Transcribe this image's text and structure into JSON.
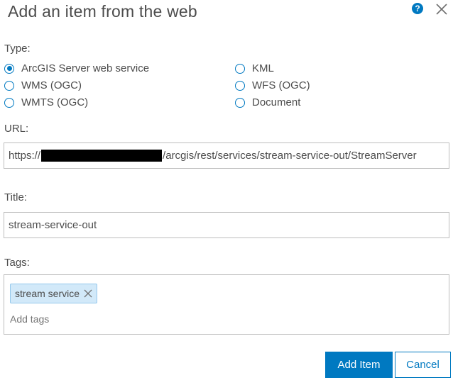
{
  "dialog": {
    "title": "Add an item from the web",
    "help_icon": "question-circle-icon",
    "close_icon": "close-icon"
  },
  "type": {
    "label": "Type:",
    "options": [
      {
        "label": "ArcGIS Server web service",
        "checked": true
      },
      {
        "label": "KML",
        "checked": false
      },
      {
        "label": "WMS (OGC)",
        "checked": false
      },
      {
        "label": "WFS (OGC)",
        "checked": false
      },
      {
        "label": "WMTS (OGC)",
        "checked": false
      },
      {
        "label": "Document",
        "checked": false
      }
    ]
  },
  "url": {
    "label": "URL:",
    "prefix": "https://",
    "suffix": "/arcgis/rest/services/stream-service-out/StreamServer"
  },
  "title_field": {
    "label": "Title:",
    "value": "stream-service-out"
  },
  "tags": {
    "label": "Tags:",
    "items": [
      "stream service"
    ],
    "placeholder": "Add tags"
  },
  "buttons": {
    "add_item": "Add Item",
    "cancel": "Cancel"
  },
  "colors": {
    "accent": "#0079c1",
    "tag_bg": "#d2e9f9",
    "text": "#4c4c4c"
  }
}
